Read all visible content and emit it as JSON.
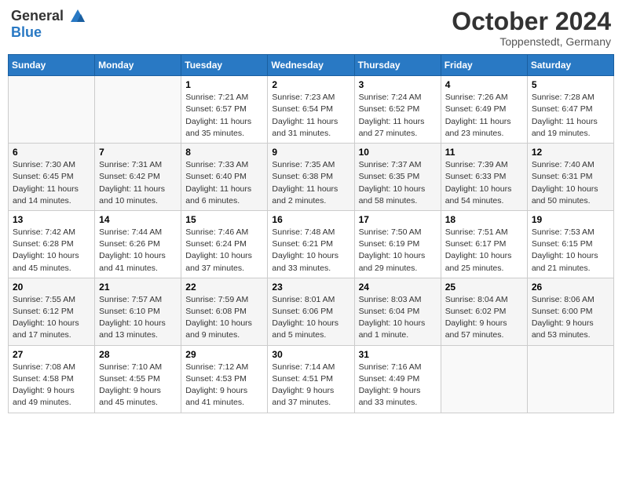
{
  "header": {
    "logo_general": "General",
    "logo_blue": "Blue",
    "month": "October 2024",
    "location": "Toppenstedt, Germany"
  },
  "weekdays": [
    "Sunday",
    "Monday",
    "Tuesday",
    "Wednesday",
    "Thursday",
    "Friday",
    "Saturday"
  ],
  "weeks": [
    [
      {
        "day": "",
        "empty": true
      },
      {
        "day": "",
        "empty": true
      },
      {
        "day": "1",
        "sunrise": "7:21 AM",
        "sunset": "6:57 PM",
        "daylight": "11 hours and 35 minutes."
      },
      {
        "day": "2",
        "sunrise": "7:23 AM",
        "sunset": "6:54 PM",
        "daylight": "11 hours and 31 minutes."
      },
      {
        "day": "3",
        "sunrise": "7:24 AM",
        "sunset": "6:52 PM",
        "daylight": "11 hours and 27 minutes."
      },
      {
        "day": "4",
        "sunrise": "7:26 AM",
        "sunset": "6:49 PM",
        "daylight": "11 hours and 23 minutes."
      },
      {
        "day": "5",
        "sunrise": "7:28 AM",
        "sunset": "6:47 PM",
        "daylight": "11 hours and 19 minutes."
      }
    ],
    [
      {
        "day": "6",
        "sunrise": "7:30 AM",
        "sunset": "6:45 PM",
        "daylight": "11 hours and 14 minutes."
      },
      {
        "day": "7",
        "sunrise": "7:31 AM",
        "sunset": "6:42 PM",
        "daylight": "11 hours and 10 minutes."
      },
      {
        "day": "8",
        "sunrise": "7:33 AM",
        "sunset": "6:40 PM",
        "daylight": "11 hours and 6 minutes."
      },
      {
        "day": "9",
        "sunrise": "7:35 AM",
        "sunset": "6:38 PM",
        "daylight": "11 hours and 2 minutes."
      },
      {
        "day": "10",
        "sunrise": "7:37 AM",
        "sunset": "6:35 PM",
        "daylight": "10 hours and 58 minutes."
      },
      {
        "day": "11",
        "sunrise": "7:39 AM",
        "sunset": "6:33 PM",
        "daylight": "10 hours and 54 minutes."
      },
      {
        "day": "12",
        "sunrise": "7:40 AM",
        "sunset": "6:31 PM",
        "daylight": "10 hours and 50 minutes."
      }
    ],
    [
      {
        "day": "13",
        "sunrise": "7:42 AM",
        "sunset": "6:28 PM",
        "daylight": "10 hours and 45 minutes."
      },
      {
        "day": "14",
        "sunrise": "7:44 AM",
        "sunset": "6:26 PM",
        "daylight": "10 hours and 41 minutes."
      },
      {
        "day": "15",
        "sunrise": "7:46 AM",
        "sunset": "6:24 PM",
        "daylight": "10 hours and 37 minutes."
      },
      {
        "day": "16",
        "sunrise": "7:48 AM",
        "sunset": "6:21 PM",
        "daylight": "10 hours and 33 minutes."
      },
      {
        "day": "17",
        "sunrise": "7:50 AM",
        "sunset": "6:19 PM",
        "daylight": "10 hours and 29 minutes."
      },
      {
        "day": "18",
        "sunrise": "7:51 AM",
        "sunset": "6:17 PM",
        "daylight": "10 hours and 25 minutes."
      },
      {
        "day": "19",
        "sunrise": "7:53 AM",
        "sunset": "6:15 PM",
        "daylight": "10 hours and 21 minutes."
      }
    ],
    [
      {
        "day": "20",
        "sunrise": "7:55 AM",
        "sunset": "6:12 PM",
        "daylight": "10 hours and 17 minutes."
      },
      {
        "day": "21",
        "sunrise": "7:57 AM",
        "sunset": "6:10 PM",
        "daylight": "10 hours and 13 minutes."
      },
      {
        "day": "22",
        "sunrise": "7:59 AM",
        "sunset": "6:08 PM",
        "daylight": "10 hours and 9 minutes."
      },
      {
        "day": "23",
        "sunrise": "8:01 AM",
        "sunset": "6:06 PM",
        "daylight": "10 hours and 5 minutes."
      },
      {
        "day": "24",
        "sunrise": "8:03 AM",
        "sunset": "6:04 PM",
        "daylight": "10 hours and 1 minute."
      },
      {
        "day": "25",
        "sunrise": "8:04 AM",
        "sunset": "6:02 PM",
        "daylight": "9 hours and 57 minutes."
      },
      {
        "day": "26",
        "sunrise": "8:06 AM",
        "sunset": "6:00 PM",
        "daylight": "9 hours and 53 minutes."
      }
    ],
    [
      {
        "day": "27",
        "sunrise": "7:08 AM",
        "sunset": "4:58 PM",
        "daylight": "9 hours and 49 minutes."
      },
      {
        "day": "28",
        "sunrise": "7:10 AM",
        "sunset": "4:55 PM",
        "daylight": "9 hours and 45 minutes."
      },
      {
        "day": "29",
        "sunrise": "7:12 AM",
        "sunset": "4:53 PM",
        "daylight": "9 hours and 41 minutes."
      },
      {
        "day": "30",
        "sunrise": "7:14 AM",
        "sunset": "4:51 PM",
        "daylight": "9 hours and 37 minutes."
      },
      {
        "day": "31",
        "sunrise": "7:16 AM",
        "sunset": "4:49 PM",
        "daylight": "9 hours and 33 minutes."
      },
      {
        "day": "",
        "empty": true
      },
      {
        "day": "",
        "empty": true
      }
    ]
  ]
}
